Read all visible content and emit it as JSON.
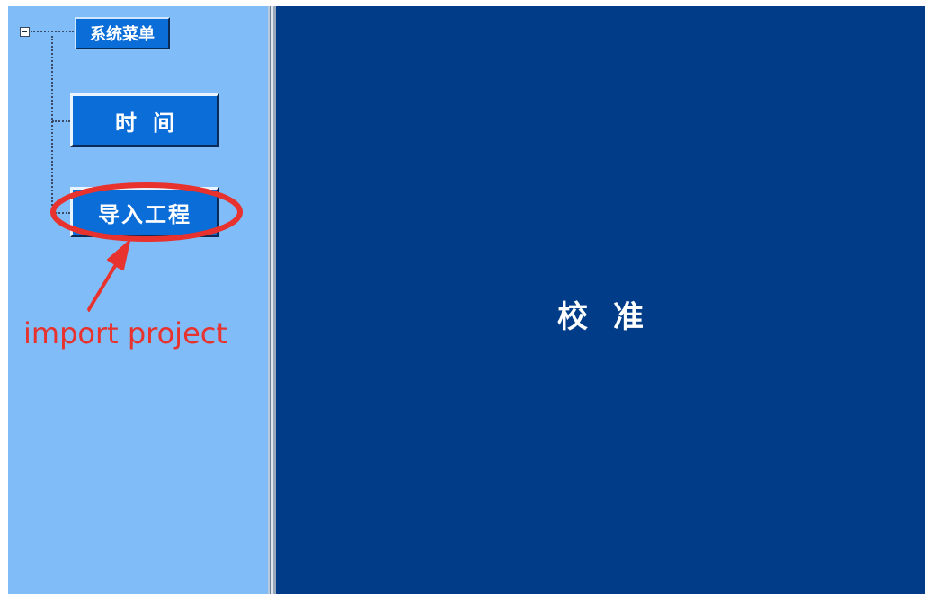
{
  "sidebar": {
    "root_label": "系统菜单",
    "items": [
      {
        "label": "时间"
      },
      {
        "label": "导入工程"
      }
    ]
  },
  "main": {
    "title": "校准"
  },
  "annotation": {
    "label": "import project",
    "color": "#e8322e"
  },
  "colors": {
    "sidebar_bg": "#7fbcf8",
    "main_bg": "#003c87",
    "button_bg": "#0a6dd8"
  }
}
